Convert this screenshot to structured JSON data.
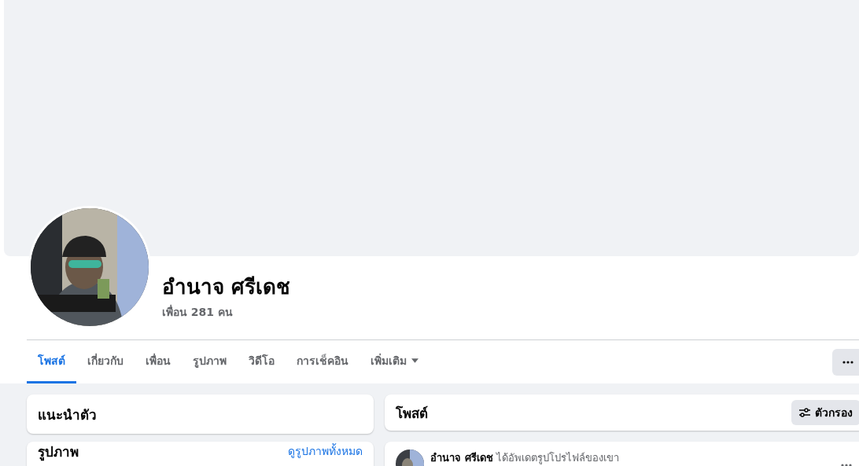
{
  "profile": {
    "name": "อำนาจ ศรีเดช",
    "friends": "เพื่อน 281 คน"
  },
  "tabs": [
    {
      "label": "โพสต์",
      "selected": true,
      "has_menu": false
    },
    {
      "label": "เกี่ยวกับ",
      "selected": false,
      "has_menu": false
    },
    {
      "label": "เพื่อน",
      "selected": false,
      "has_menu": false
    },
    {
      "label": "รูปภาพ",
      "selected": false,
      "has_menu": false
    },
    {
      "label": "วิดีโอ",
      "selected": false,
      "has_menu": false
    },
    {
      "label": "การเช็คอิน",
      "selected": false,
      "has_menu": false
    },
    {
      "label": "เพิ่มเติม",
      "selected": false,
      "has_menu": true
    }
  ],
  "intro_card": {
    "title": "แนะนำตัว"
  },
  "photos_card": {
    "title": "รูปภาพ",
    "link": "ดูรูปภาพทั้งหมด"
  },
  "posts_header": {
    "title": "โพสต์",
    "filter_button": "ตัวกรอง"
  },
  "post": {
    "author": "อำนาจ ศรีเดช",
    "action": "ได้อัพเดตรูปโปรไฟล์ของเขา"
  }
}
